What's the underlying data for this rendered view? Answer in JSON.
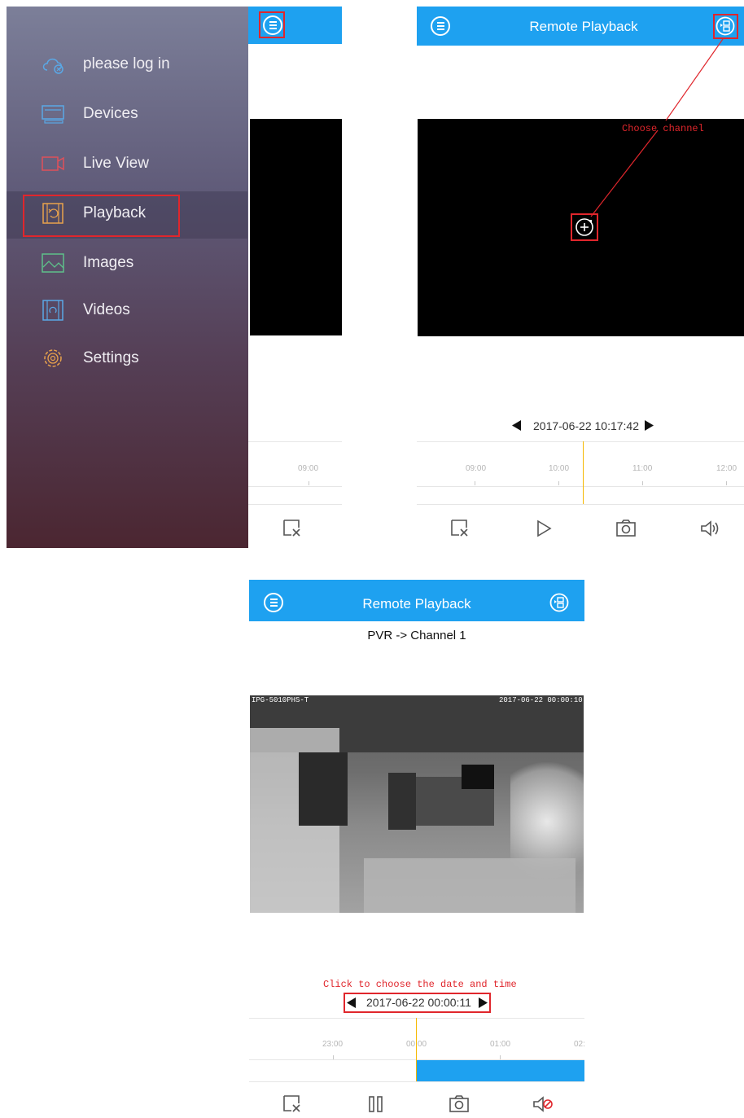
{
  "left_panel": {
    "menu_items": [
      {
        "label": "please log in",
        "icon": "cloud-icon"
      },
      {
        "label": "Devices",
        "icon": "devices-icon"
      },
      {
        "label": "Live View",
        "icon": "video-camera-icon"
      },
      {
        "label": "Playback",
        "icon": "playback-icon"
      },
      {
        "label": "Images",
        "icon": "image-icon"
      },
      {
        "label": "Videos",
        "icon": "video-file-icon"
      },
      {
        "label": "Settings",
        "icon": "gear-icon"
      }
    ],
    "timeline_label": "09:00"
  },
  "top_right": {
    "title": "Remote Playback",
    "annotation": "Choose channel",
    "datetime": "2017-06-22 10:17:42",
    "timeline_labels": [
      "09:00",
      "10:00",
      "11:00",
      "12:00"
    ]
  },
  "bottom": {
    "title": "Remote Playback",
    "channel": "PVR -> Channel 1",
    "osd_left": "IPG-5010PHS-T",
    "osd_right": "2017-06-22 00:00:10",
    "annotation": "Click to choose the date and time",
    "datetime": "2017-06-22 00:00:11",
    "timeline_labels": [
      "23:00",
      "00:00",
      "01:00",
      "02:"
    ]
  },
  "colors": {
    "accent": "#1ea1f0",
    "annotation": "#e0262c",
    "cursor": "#f5b800"
  }
}
